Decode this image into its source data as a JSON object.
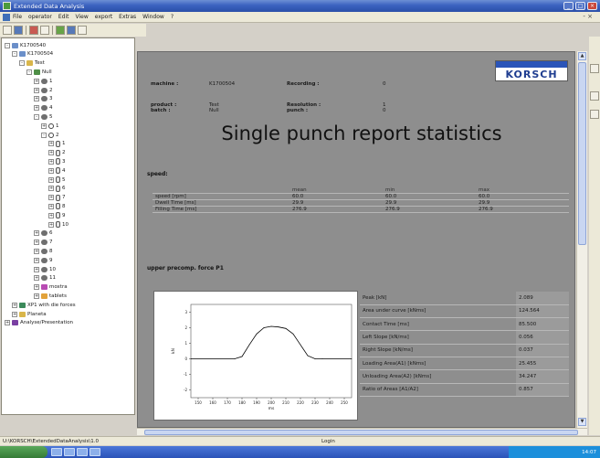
{
  "window": {
    "title": "Extended Data Analysis",
    "buttons": [
      "_",
      "□",
      "×"
    ]
  },
  "menu": {
    "items": [
      "File",
      "operator",
      "Edit",
      "View",
      "export",
      "Extras",
      "Window",
      "?"
    ],
    "right_controls": "- ×"
  },
  "toolbar": {
    "icons": [
      "save-icon",
      "open-icon",
      "report-icon",
      "print-icon",
      "chart-icon",
      "measure-icon",
      "help-icon"
    ]
  },
  "tree": {
    "items": [
      {
        "label": "K1700540",
        "level": 0,
        "icon": "pc",
        "expander": "-"
      },
      {
        "label": "K1700504",
        "level": 1,
        "icon": "pc",
        "expander": "-"
      },
      {
        "label": "Test",
        "level": 2,
        "icon": "folder",
        "expander": "-"
      },
      {
        "label": "Null",
        "level": 3,
        "icon": "batch",
        "expander": "-"
      },
      {
        "label": "1",
        "level": 4,
        "icon": "punch",
        "expander": "+"
      },
      {
        "label": "2",
        "level": 4,
        "icon": "punch",
        "expander": "+"
      },
      {
        "label": "3",
        "level": 4,
        "icon": "punch",
        "expander": "+"
      },
      {
        "label": "4",
        "level": 4,
        "icon": "punch",
        "expander": "+"
      },
      {
        "label": "5",
        "level": 4,
        "icon": "punch",
        "expander": "-"
      },
      {
        "label": "1",
        "level": 5,
        "icon": "circle",
        "expander": "+"
      },
      {
        "label": "2",
        "level": 5,
        "icon": "circle",
        "expander": "-"
      },
      {
        "label": "1",
        "level": 6,
        "icon": "station",
        "expander": "+"
      },
      {
        "label": "2",
        "level": 6,
        "icon": "station",
        "expander": "+"
      },
      {
        "label": "3",
        "level": 6,
        "icon": "station",
        "expander": "+"
      },
      {
        "label": "4",
        "level": 6,
        "icon": "station",
        "expander": "+"
      },
      {
        "label": "5",
        "level": 6,
        "icon": "station",
        "expander": "+"
      },
      {
        "label": "6",
        "level": 6,
        "icon": "station",
        "expander": "+"
      },
      {
        "label": "7",
        "level": 6,
        "icon": "station",
        "expander": "+"
      },
      {
        "label": "8",
        "level": 6,
        "icon": "station",
        "expander": "+"
      },
      {
        "label": "9",
        "level": 6,
        "icon": "station",
        "expander": "+"
      },
      {
        "label": "10",
        "level": 6,
        "icon": "station",
        "expander": "+"
      },
      {
        "label": "6",
        "level": 4,
        "icon": "punch",
        "expander": "+"
      },
      {
        "label": "7",
        "level": 4,
        "icon": "punch",
        "expander": "+"
      },
      {
        "label": "8",
        "level": 4,
        "icon": "punch",
        "expander": "+"
      },
      {
        "label": "9",
        "level": 4,
        "icon": "punch",
        "expander": "+"
      },
      {
        "label": "10",
        "level": 4,
        "icon": "punch",
        "expander": "+"
      },
      {
        "label": "11",
        "level": 4,
        "icon": "punch",
        "expander": "+"
      },
      {
        "label": "moxtra",
        "level": 4,
        "icon": "star",
        "expander": "+"
      },
      {
        "label": "tablets",
        "level": 4,
        "icon": "doc",
        "expander": "+"
      },
      {
        "label": "XP1 with die forces",
        "level": 1,
        "icon": "curve",
        "expander": "+"
      },
      {
        "label": "Planeta",
        "level": 1,
        "icon": "folder",
        "expander": "+"
      },
      {
        "label": "Analyse/Presentation",
        "level": 0,
        "icon": "shield",
        "expander": "+"
      }
    ]
  },
  "report": {
    "header_left": [
      {
        "label": "machine :",
        "value": "K1700504"
      },
      {
        "label": "product :",
        "value": "Test"
      },
      {
        "label": "batch :",
        "value": "Null"
      }
    ],
    "header_right": [
      {
        "label": "Recording :",
        "value": "0"
      },
      {
        "label": "Resolution :",
        "value": "1"
      },
      {
        "label": "punch :",
        "value": "0"
      }
    ],
    "logo": "KORSCH",
    "title": "Single punch report statistics",
    "speed": {
      "section_title": "speed:",
      "columns": [
        "",
        "mean",
        "min",
        "max"
      ],
      "rows": [
        [
          "speed [rpm]",
          "60.0",
          "60.0",
          "60.0"
        ],
        [
          "Dwell Time [ms]",
          "29.9",
          "29.9",
          "29.9"
        ],
        [
          "Filling Time [ms]",
          "276.9",
          "276.9",
          "276.9"
        ]
      ]
    },
    "precomp": {
      "section_title": "upper precomp. force P1",
      "stats": [
        {
          "label": "Peak [kN]",
          "value": "2.089"
        },
        {
          "label": "Area under curve [kNms]",
          "value": "124.564"
        },
        {
          "label": "Contact Time [ms]",
          "value": "85.500"
        },
        {
          "label": "Left Slope [kN/ms]",
          "value": "0.056"
        },
        {
          "label": "Right Slope [kN/ms]",
          "value": "0.037"
        },
        {
          "label": "Loading Area(A1) [kNms]",
          "value": "25.455"
        },
        {
          "label": "Unloading Area(A2) [kNms]",
          "value": "34.247"
        },
        {
          "label": "Ratio of Areas [A1/A2]",
          "value": "0.857"
        }
      ]
    }
  },
  "chart_data": {
    "type": "line",
    "title": "",
    "xlabel": "ms",
    "ylabel": "kN",
    "x_ticks": [
      150,
      160,
      170,
      180,
      190,
      200,
      210,
      220,
      230,
      240,
      250
    ],
    "y_ticks": [
      -2,
      -1,
      0,
      1,
      2,
      3
    ],
    "xlim": [
      145,
      255
    ],
    "ylim": [
      -2.5,
      3.5
    ],
    "grid": false,
    "series": [
      {
        "color": "#000000",
        "x": [
          145,
          175,
          180,
          185,
          190,
          195,
          200,
          205,
          210,
          215,
          220,
          225,
          230,
          235,
          255
        ],
        "y": [
          0,
          0,
          0.15,
          0.9,
          1.6,
          2.0,
          2.09,
          2.05,
          1.95,
          1.6,
          0.9,
          0.2,
          0,
          0,
          0
        ]
      }
    ]
  },
  "statusbar": {
    "path": "U:\\KORSCH\\ExtendedDataAnalysis\\1.0",
    "login": "Login"
  },
  "taskbar": {
    "clock": "14:07"
  }
}
